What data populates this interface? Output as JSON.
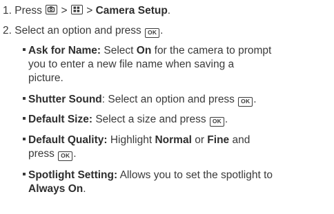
{
  "steps": [
    {
      "number": "1.",
      "prefix": "Press",
      "separator": ">",
      "target": "Camera Setup",
      "suffix": "."
    },
    {
      "number": "2.",
      "text": "Select an option and press",
      "suffix": "."
    }
  ],
  "ok_label": "OK",
  "options": [
    {
      "term": "Ask for Name:",
      "lines": [
        [
          "Select ",
          "On",
          " for the camera to prompt"
        ],
        "you to enter a new file name when saving a",
        "picture."
      ]
    },
    {
      "term": "Shutter Sound",
      "text": ": Select an option and press",
      "suffix": "."
    },
    {
      "term": "Default Size:",
      "text": " Select a size and press",
      "suffix": "."
    },
    {
      "term": "Default Quality:",
      "text_a": " Highlight ",
      "bold_a": "Normal",
      "text_b": " or ",
      "bold_b": "Fine",
      "text_c": " and",
      "line2": "press",
      "suffix": "."
    },
    {
      "term": "Spotlight Setting:",
      "text": " Allows you to set the spotlight to",
      "line2_bold": "Always On",
      "suffix": "."
    }
  ],
  "icons": {
    "camera_key": "camera-key-icon",
    "menu_key": "menu-grid-key-icon",
    "ok_key": "ok-key-icon"
  }
}
